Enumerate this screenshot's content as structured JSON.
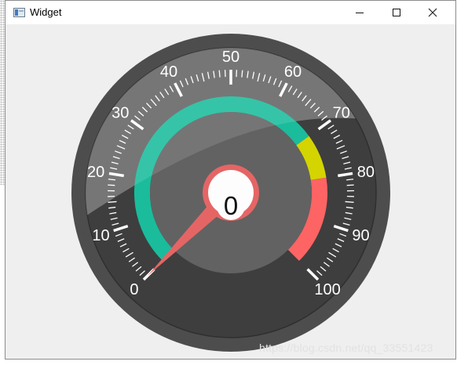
{
  "window": {
    "title": "Widget",
    "controls": {
      "minimize": "minimize",
      "maximize": "maximize",
      "close": "close"
    }
  },
  "gauge": {
    "value": 0,
    "min": 0,
    "max": 100,
    "tick_labels": [
      "0",
      "10",
      "20",
      "30",
      "40",
      "50",
      "60",
      "70",
      "80",
      "90",
      "100"
    ],
    "ranges": [
      {
        "from": 0,
        "to": 70,
        "color": "#1abc9c"
      },
      {
        "from": 70,
        "to": 80,
        "color": "#d4d400"
      },
      {
        "from": 80,
        "to": 100,
        "color": "#ff6464"
      }
    ],
    "colors": {
      "outer_ring": "#4d4d4d",
      "face": "#3e3e3e",
      "inner_disc": "#626262",
      "needle": "#e56565",
      "ticks": "#ffffff"
    }
  },
  "watermark": "https://blog.csdn.net/qq_33551423"
}
